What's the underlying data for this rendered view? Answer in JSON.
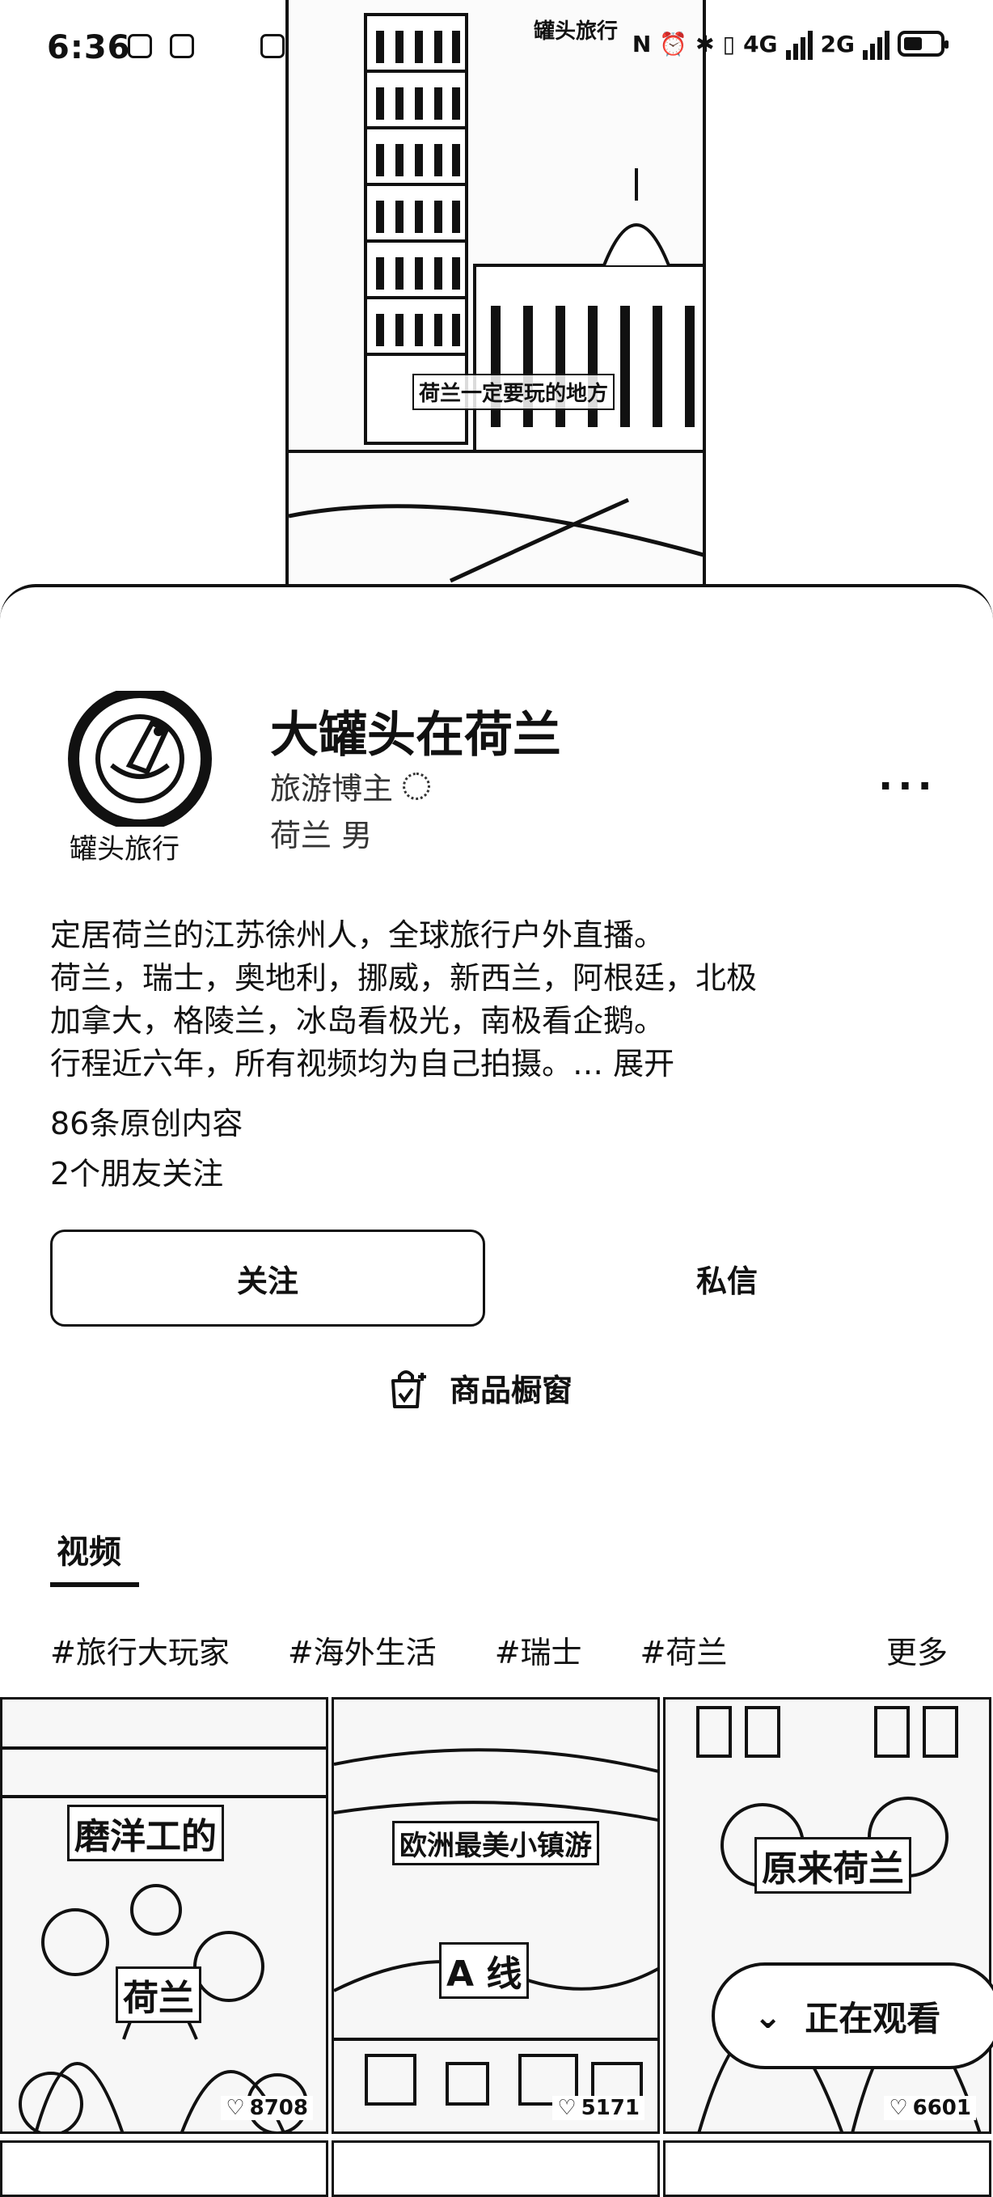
{
  "status_bar": {
    "time": "6:36",
    "network_1": "4G",
    "network_2": "2G"
  },
  "hero": {
    "watermark": "罐头旅行",
    "caption": "荷兰一定要玩的地方"
  },
  "profile": {
    "avatar_caption": "罐头旅行",
    "name": "大罐头在荷兰",
    "role": "旅游博主",
    "location": "荷兰 男",
    "more": "···",
    "bio": [
      "定居荷兰的江苏徐州人，全球旅行户外直播。",
      "荷兰，瑞士，奥地利，挪威，新西兰，阿根廷，北极",
      "加拿大，格陵兰，冰岛看极光，南极看企鹅。",
      "行程近六年，所有视频均为自己拍摄。… "
    ],
    "expand": "展开",
    "original_count": "86条原创内容",
    "friends_following": "2个朋友关注"
  },
  "actions": {
    "follow": "关注",
    "message": "私信",
    "shop": "商品橱窗"
  },
  "tabs": {
    "video": "视频"
  },
  "tags": [
    "#旅行大玩家",
    "#海外生活",
    "#瑞士",
    "#荷兰"
  ],
  "tags_more": "更多",
  "videos": [
    {
      "title_1": "磨洋工的",
      "title_2": "荷兰",
      "likes": "8708"
    },
    {
      "title_1": "欧洲最美小镇游",
      "title_2": "A 线",
      "likes": "5171"
    },
    {
      "title_1": "原来荷兰",
      "likes": "6601"
    }
  ],
  "floating": {
    "watching": "正在观看"
  },
  "colors": {
    "ink": "#111111",
    "background": "#ffffff"
  }
}
